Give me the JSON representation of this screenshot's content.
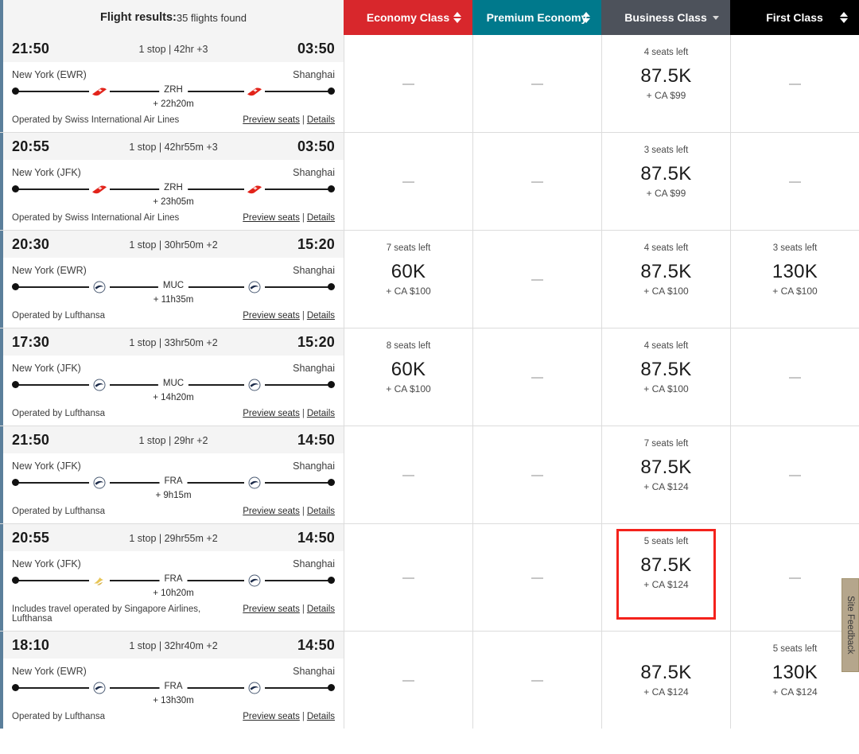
{
  "header": {
    "results_label": "Flight results:",
    "results_count": "35 flights found",
    "columns": [
      {
        "label": "Economy Class",
        "color": "#d8272c",
        "sort_icon": "sort-updown-icon"
      },
      {
        "label": "Premium Economy",
        "color": "#00798c",
        "sort_icon": "sort-updown-icon"
      },
      {
        "label": "Business Class",
        "color": "#4d525b",
        "sort_icon": "chevron-down-icon"
      },
      {
        "label": "First Class",
        "color": "#000000",
        "sort_icon": "sort-updown-icon"
      }
    ]
  },
  "links": {
    "preview_seats": "Preview seats",
    "details": "Details",
    "separator": "|"
  },
  "empty_marker": "—",
  "feedback_tab": {
    "label": "Site Feedback"
  },
  "highlight_color": "#f4221c",
  "flights": [
    {
      "depart_time": "21:50",
      "summary": "1 stop | 42hr +3",
      "arrive_time": "03:50",
      "origin": "New York (EWR)",
      "destination": "Shanghai",
      "stop_code": "ZRH",
      "layover": "+ 22h20m",
      "operator": "Operated by Swiss International Air Lines",
      "carrier_icons": [
        "swiss-logo-icon",
        "swiss-logo-icon"
      ],
      "fares": [
        {
          "seats": "",
          "miles": "",
          "taxes": "",
          "available": false
        },
        {
          "seats": "",
          "miles": "",
          "taxes": "",
          "available": false
        },
        {
          "seats": "4 seats left",
          "miles": "87.5K",
          "taxes": "+ CA $99",
          "available": true
        },
        {
          "seats": "",
          "miles": "",
          "taxes": "",
          "available": false
        }
      ]
    },
    {
      "depart_time": "20:55",
      "summary": "1 stop | 42hr55m +3",
      "arrive_time": "03:50",
      "origin": "New York (JFK)",
      "destination": "Shanghai",
      "stop_code": "ZRH",
      "layover": "+ 23h05m",
      "operator": "Operated by Swiss International Air Lines",
      "carrier_icons": [
        "swiss-logo-icon",
        "swiss-logo-icon"
      ],
      "fares": [
        {
          "seats": "",
          "miles": "",
          "taxes": "",
          "available": false
        },
        {
          "seats": "",
          "miles": "",
          "taxes": "",
          "available": false
        },
        {
          "seats": "3 seats left",
          "miles": "87.5K",
          "taxes": "+ CA $99",
          "available": true
        },
        {
          "seats": "",
          "miles": "",
          "taxes": "",
          "available": false
        }
      ]
    },
    {
      "depart_time": "20:30",
      "summary": "1 stop | 30hr50m +2",
      "arrive_time": "15:20",
      "origin": "New York (EWR)",
      "destination": "Shanghai",
      "stop_code": "MUC",
      "layover": "+ 11h35m",
      "operator": "Operated by Lufthansa",
      "carrier_icons": [
        "lufthansa-logo-icon",
        "lufthansa-logo-icon"
      ],
      "fares": [
        {
          "seats": "7 seats left",
          "miles": "60K",
          "taxes": "+ CA $100",
          "available": true
        },
        {
          "seats": "",
          "miles": "",
          "taxes": "",
          "available": false
        },
        {
          "seats": "4 seats left",
          "miles": "87.5K",
          "taxes": "+ CA $100",
          "available": true
        },
        {
          "seats": "3 seats left",
          "miles": "130K",
          "taxes": "+ CA $100",
          "available": true
        }
      ]
    },
    {
      "depart_time": "17:30",
      "summary": "1 stop | 33hr50m +2",
      "arrive_time": "15:20",
      "origin": "New York (JFK)",
      "destination": "Shanghai",
      "stop_code": "MUC",
      "layover": "+ 14h20m",
      "operator": "Operated by Lufthansa",
      "carrier_icons": [
        "lufthansa-logo-icon",
        "lufthansa-logo-icon"
      ],
      "fares": [
        {
          "seats": "8 seats left",
          "miles": "60K",
          "taxes": "+ CA $100",
          "available": true
        },
        {
          "seats": "",
          "miles": "",
          "taxes": "",
          "available": false
        },
        {
          "seats": "4 seats left",
          "miles": "87.5K",
          "taxes": "+ CA $100",
          "available": true
        },
        {
          "seats": "",
          "miles": "",
          "taxes": "",
          "available": false
        }
      ]
    },
    {
      "depart_time": "21:50",
      "summary": "1 stop | 29hr +2",
      "arrive_time": "14:50",
      "origin": "New York (JFK)",
      "destination": "Shanghai",
      "stop_code": "FRA",
      "layover": "+ 9h15m",
      "operator": "Operated by Lufthansa",
      "carrier_icons": [
        "lufthansa-logo-icon",
        "lufthansa-logo-icon"
      ],
      "fares": [
        {
          "seats": "",
          "miles": "",
          "taxes": "",
          "available": false
        },
        {
          "seats": "",
          "miles": "",
          "taxes": "",
          "available": false
        },
        {
          "seats": "7 seats left",
          "miles": "87.5K",
          "taxes": "+ CA $124",
          "available": true
        },
        {
          "seats": "",
          "miles": "",
          "taxes": "",
          "available": false
        }
      ]
    },
    {
      "depart_time": "20:55",
      "summary": "1 stop | 29hr55m +2",
      "arrive_time": "14:50",
      "origin": "New York (JFK)",
      "destination": "Shanghai",
      "stop_code": "FRA",
      "layover": "+ 10h20m",
      "operator": "Includes travel operated by Singapore Airlines, Lufthansa",
      "carrier_icons": [
        "singapore-airlines-logo-icon",
        "lufthansa-logo-icon"
      ],
      "fares": [
        {
          "seats": "",
          "miles": "",
          "taxes": "",
          "available": false
        },
        {
          "seats": "",
          "miles": "",
          "taxes": "",
          "available": false
        },
        {
          "seats": "5 seats left",
          "miles": "87.5K",
          "taxes": "+ CA $124",
          "available": true,
          "highlighted": true
        },
        {
          "seats": "",
          "miles": "",
          "taxes": "",
          "available": false
        }
      ]
    },
    {
      "depart_time": "18:10",
      "summary": "1 stop | 32hr40m +2",
      "arrive_time": "14:50",
      "origin": "New York (EWR)",
      "destination": "Shanghai",
      "stop_code": "FRA",
      "layover": "+ 13h30m",
      "operator": "Operated by Lufthansa",
      "carrier_icons": [
        "lufthansa-logo-icon",
        "lufthansa-logo-icon"
      ],
      "fares": [
        {
          "seats": "",
          "miles": "",
          "taxes": "",
          "available": false
        },
        {
          "seats": "",
          "miles": "",
          "taxes": "",
          "available": false
        },
        {
          "seats": "",
          "miles": "87.5K",
          "taxes": "+ CA $124",
          "available": true
        },
        {
          "seats": "5 seats left",
          "miles": "130K",
          "taxes": "+ CA $124",
          "available": true
        }
      ]
    }
  ]
}
